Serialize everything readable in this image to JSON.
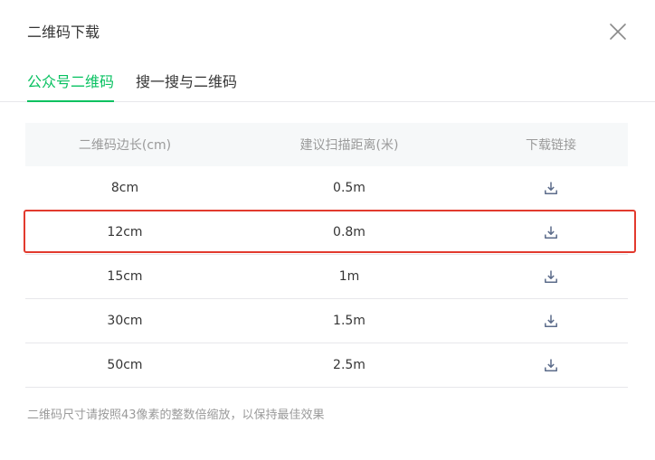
{
  "dialog": {
    "title": "二维码下载",
    "close_icon": "close-icon"
  },
  "tabs": [
    {
      "label": "公众号二维码",
      "active": true
    },
    {
      "label": "搜一搜与二维码",
      "active": false
    }
  ],
  "table": {
    "headers": [
      "二维码边长(cm)",
      "建议扫描距离(米)",
      "下载链接"
    ],
    "rows": [
      {
        "size": "8cm",
        "distance": "0.5m",
        "download_icon": "download-icon"
      },
      {
        "size": "12cm",
        "distance": "0.8m",
        "download_icon": "download-icon",
        "highlighted": true
      },
      {
        "size": "15cm",
        "distance": "1m",
        "download_icon": "download-icon"
      },
      {
        "size": "30cm",
        "distance": "1.5m",
        "download_icon": "download-icon"
      },
      {
        "size": "50cm",
        "distance": "2.5m",
        "download_icon": "download-icon"
      }
    ]
  },
  "note": "二维码尺寸请按照43像素的整数倍缩放，以保持最佳效果",
  "colors": {
    "accent": "#07c160",
    "highlight": "#e23a2e",
    "icon": "#5b6b8a"
  }
}
